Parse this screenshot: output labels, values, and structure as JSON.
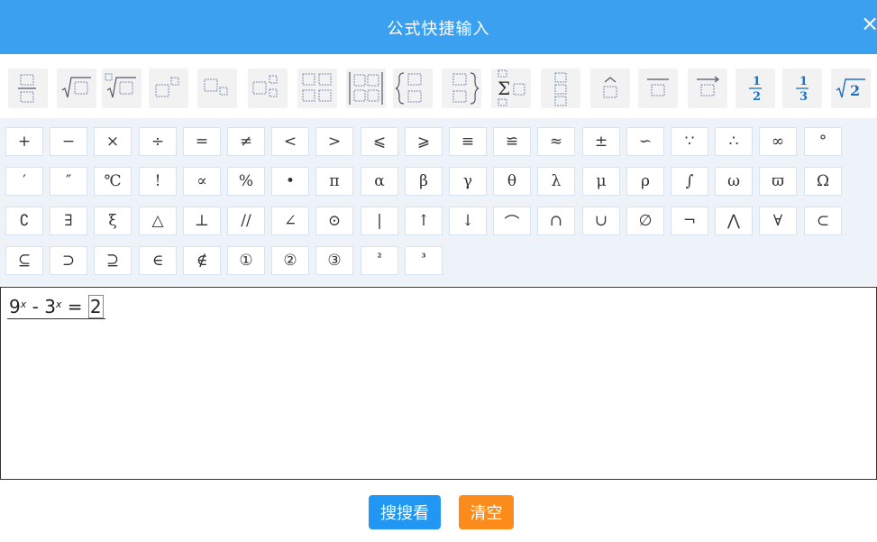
{
  "dialog": {
    "title": "公式快捷输入",
    "close": "×"
  },
  "templates": [
    {
      "name": "fraction-template"
    },
    {
      "name": "square-root-template"
    },
    {
      "name": "nth-root-template"
    },
    {
      "name": "superscript-template"
    },
    {
      "name": "subscript-template"
    },
    {
      "name": "sub-superscript-template"
    },
    {
      "name": "matrix-2x2-template"
    },
    {
      "name": "determinant-template"
    },
    {
      "name": "left-brace-template"
    },
    {
      "name": "right-brace-template"
    },
    {
      "name": "summation-template"
    },
    {
      "name": "stacked-box-template"
    },
    {
      "name": "hat-template"
    },
    {
      "name": "overline-template"
    },
    {
      "name": "vector-template"
    },
    {
      "name": "one-half-template",
      "label": "1/2"
    },
    {
      "name": "one-third-template",
      "label": "1/3"
    },
    {
      "name": "sqrt2-template",
      "label": "√2"
    }
  ],
  "symbols": [
    [
      "+",
      "−",
      "×",
      "÷",
      "=",
      "≠",
      "<",
      ">",
      "⩽",
      "⩾",
      "≡",
      "≌",
      "≈",
      "±",
      "∽",
      "∵",
      "∴",
      "∞",
      "°"
    ],
    [
      "′",
      "″",
      "℃",
      "!",
      "∝",
      "%",
      "•",
      "π",
      "α",
      "β",
      "γ",
      "θ",
      "λ",
      "μ",
      "ρ",
      "∫",
      "ω",
      "ϖ",
      "Ω"
    ],
    [
      "∁",
      "∃",
      "ξ",
      "△",
      "⊥",
      "//",
      "∠",
      "⊙",
      "|",
      "↑",
      "↓",
      "⌒",
      "∩",
      "∪",
      "∅",
      "¬",
      "⋀",
      "∀",
      "⊂"
    ],
    [
      "⊆",
      "⊃",
      "⊇",
      "∈",
      "∉",
      "①",
      "②",
      "③",
      "²",
      "³"
    ]
  ],
  "editor": {
    "formula": {
      "base1": "9",
      "exp1": "x",
      "op": " - ",
      "base2": "3",
      "exp2": "x",
      "eq": " = ",
      "rhs": "2"
    }
  },
  "buttons": {
    "search": "搜搜看",
    "clear": "清空"
  },
  "colors": {
    "header": "#3aa0ef",
    "search_button": "#2196f3",
    "clear_button": "#fb8c1c",
    "symbol_panel": "#eef3fa"
  }
}
